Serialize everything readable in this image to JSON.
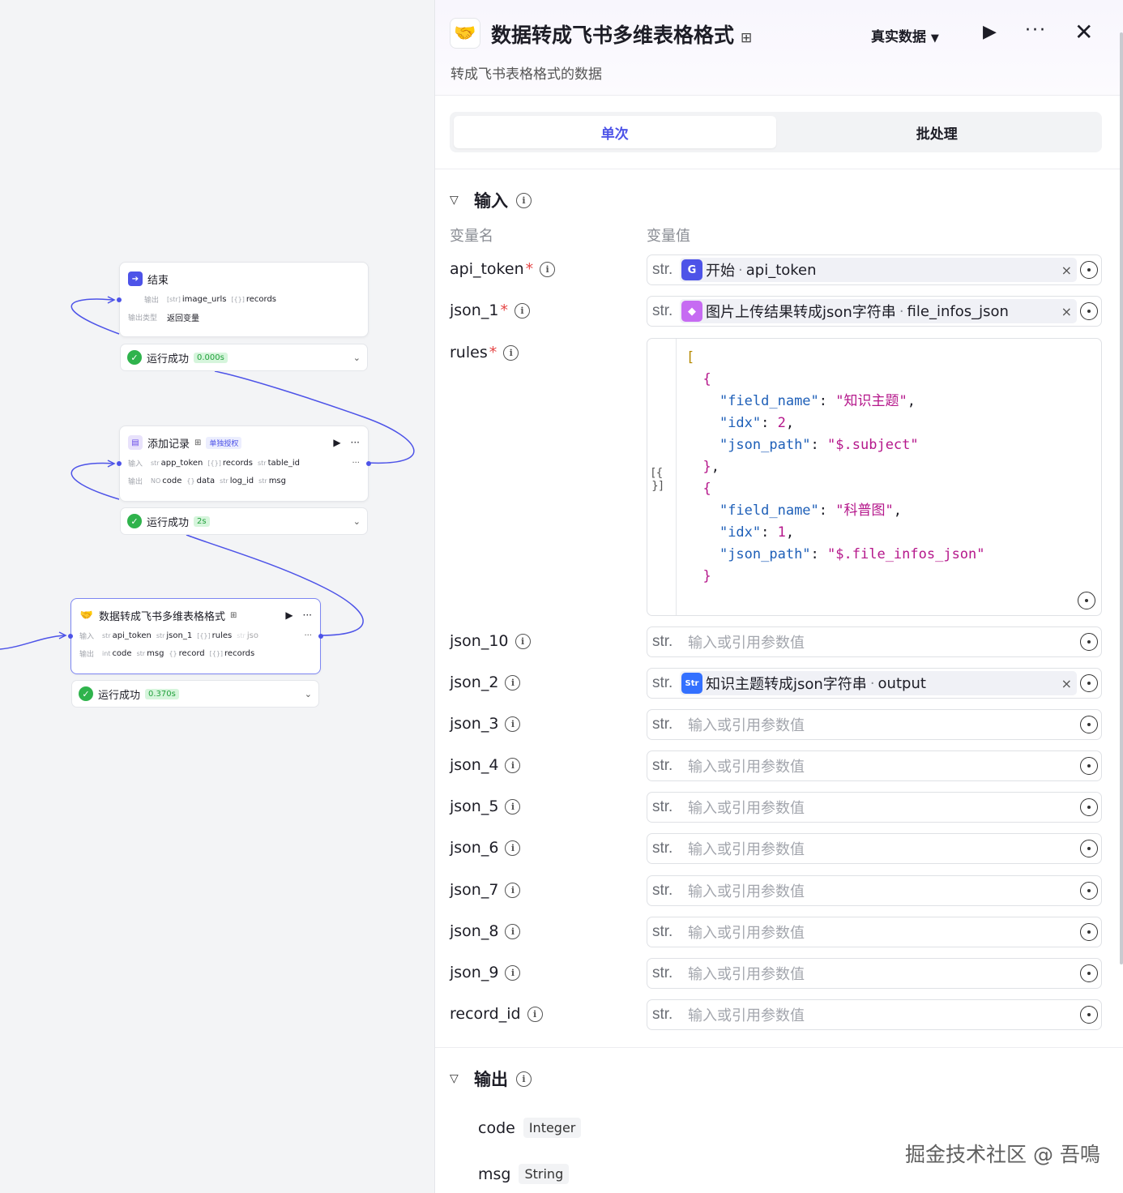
{
  "canvas": {
    "end_node": {
      "title": "结束",
      "out_label": "输出",
      "outputs": [
        {
          "type": "[str]",
          "name": "image_urls"
        },
        {
          "type": "[{}]",
          "name": "records"
        }
      ],
      "return_label": "输出类型",
      "return_value": "返回变量",
      "status": "运行成功",
      "duration": "0.000s"
    },
    "add_node": {
      "title": "添加记录",
      "auth": "单独授权",
      "in_label": "输入",
      "out_label": "输出",
      "inputs": [
        {
          "type": "str",
          "name": "app_token"
        },
        {
          "type": "[{}]",
          "name": "records"
        },
        {
          "type": "str",
          "name": "table_id"
        }
      ],
      "outputs": [
        {
          "type": "NO",
          "name": "code"
        },
        {
          "type": "{}",
          "name": "data"
        },
        {
          "type": "str",
          "name": "log_id"
        },
        {
          "type": "str",
          "name": "msg"
        }
      ],
      "more": "···",
      "status": "运行成功",
      "duration": "2s"
    },
    "convert_node": {
      "title": "数据转成飞书多维表格格式",
      "in_label": "输入",
      "out_label": "输出",
      "inputs": [
        {
          "type": "str",
          "name": "api_token"
        },
        {
          "type": "str",
          "name": "json_1"
        },
        {
          "type": "[{}]",
          "name": "rules"
        },
        {
          "type": "str",
          "name": "jso"
        }
      ],
      "outputs": [
        {
          "type": "int",
          "name": "code"
        },
        {
          "type": "str",
          "name": "msg"
        },
        {
          "type": "{}",
          "name": "record"
        },
        {
          "type": "[{}]",
          "name": "records"
        }
      ],
      "more": "···",
      "status": "运行成功",
      "duration": "0.370s"
    }
  },
  "panel": {
    "title": "数据转成飞书多维表格格式",
    "subtitle": "转成飞书表格格式的数据",
    "data_mode": "真实数据",
    "tabs": [
      "单次",
      "批处理"
    ],
    "active_tab": "单次",
    "input_section": "输入",
    "col_name": "变量名",
    "col_value": "变量值",
    "type_prefix": "str.",
    "placeholder": "输入或引用参数值",
    "vars": {
      "api_token": {
        "name": "api_token",
        "required": true,
        "ref_node": "开始",
        "ref_var": "api_token"
      },
      "json_1": {
        "name": "json_1",
        "required": true,
        "ref_node": "图片上传结果转成json字符串",
        "ref_var": "file_infos_json"
      },
      "rules": {
        "name": "rules",
        "required": true,
        "gutter": "[{ }]"
      },
      "json_10": {
        "name": "json_10"
      },
      "json_2": {
        "name": "json_2",
        "ref_node": "知识主题转成json字符串",
        "ref_var": "output"
      },
      "json_3": {
        "name": "json_3"
      },
      "json_4": {
        "name": "json_4"
      },
      "json_5": {
        "name": "json_5"
      },
      "json_6": {
        "name": "json_6"
      },
      "json_7": {
        "name": "json_7"
      },
      "json_8": {
        "name": "json_8"
      },
      "json_9": {
        "name": "json_9"
      },
      "record_id": {
        "name": "record_id"
      }
    },
    "rules_code": {
      "rule1": {
        "field_name": "知识主题",
        "idx": "2",
        "json_path": "$.subject"
      },
      "rule2": {
        "field_name": "科普图",
        "idx": "1",
        "json_path": "$.file_infos_json"
      }
    },
    "output_section": "输出",
    "outputs": [
      {
        "name": "code",
        "type": "Integer"
      },
      {
        "name": "msg",
        "type": "String"
      }
    ],
    "watermark": "掘金技术社区 @ 吾鳴"
  },
  "colors": {
    "accent": "#4d53e8",
    "success": "#2fb34c",
    "wire": "#4d53e8"
  }
}
